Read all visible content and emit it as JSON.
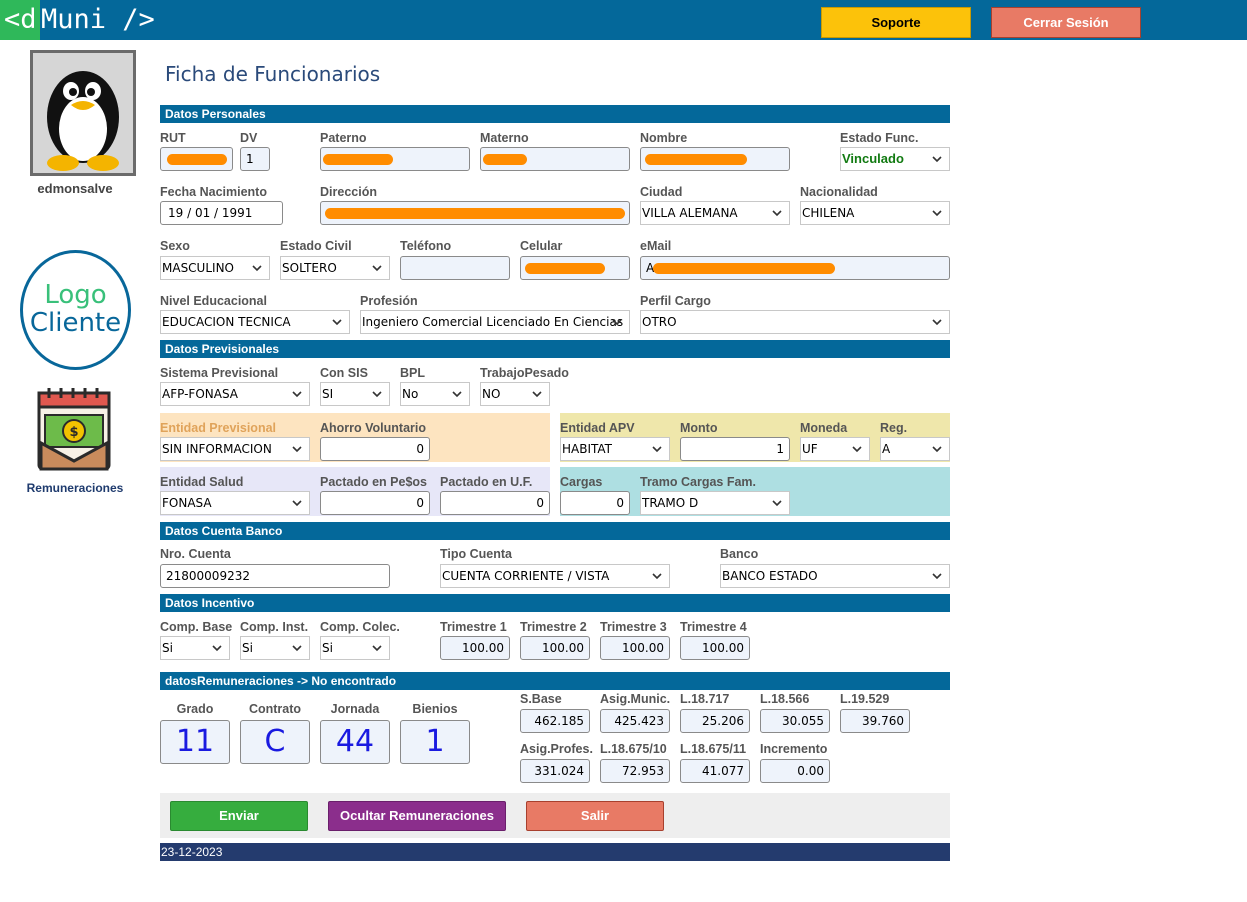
{
  "app": {
    "logo_d": "<d",
    "logo_rest": "Muni />"
  },
  "topbar": {
    "soporte": "Soporte",
    "cerrar_sesion": "Cerrar Sesión"
  },
  "sidebar": {
    "username": "edmonsalve",
    "client_logo_line1": "Logo",
    "client_logo_line2": "Cliente",
    "remuneraciones": "Remuneraciones"
  },
  "page": {
    "title": "Ficha de Funcionarios"
  },
  "sections": {
    "personales": "Datos Personales",
    "previsionales": "Datos Previsionales",
    "banco": "Datos Cuenta Banco",
    "incentivo": "Datos Incentivo",
    "remuneraciones": "datosRemuneraciones -> No encontrado"
  },
  "personales": {
    "rut": {
      "label": "RUT",
      "value": ""
    },
    "dv": {
      "label": "DV",
      "value": "1"
    },
    "paterno": {
      "label": "Paterno",
      "value": ""
    },
    "materno": {
      "label": "Materno",
      "value": ""
    },
    "nombre": {
      "label": "Nombre",
      "value": ""
    },
    "estado_func": {
      "label": "Estado Func.",
      "value": "Vinculado"
    },
    "fecha_nac": {
      "label": "Fecha Nacimiento",
      "value": "19 / 01 / 1991"
    },
    "direccion": {
      "label": "Dirección",
      "value": ""
    },
    "ciudad": {
      "label": "Ciudad",
      "value": "VILLA ALEMANA"
    },
    "nacionalidad": {
      "label": "Nacionalidad",
      "value": "CHILENA"
    },
    "sexo": {
      "label": "Sexo",
      "value": "MASCULINO"
    },
    "estado_civil": {
      "label": "Estado Civil",
      "value": "SOLTERO"
    },
    "telefono": {
      "label": "Teléfono",
      "value": ""
    },
    "celular": {
      "label": "Celular",
      "value": ""
    },
    "email": {
      "label": "eMail",
      "value": "A"
    },
    "nivel_educ": {
      "label": "Nivel Educacional",
      "value": "EDUCACION TECNICA"
    },
    "profesion": {
      "label": "Profesión",
      "value": "Ingeniero Comercial Licenciado En Ciencias"
    },
    "perfil_cargo": {
      "label": "Perfil Cargo",
      "value": "OTRO"
    }
  },
  "previsionales": {
    "sistema": {
      "label": "Sistema Previsional",
      "value": "AFP-FONASA"
    },
    "con_sis": {
      "label": "Con SIS",
      "value": "SI"
    },
    "bpl": {
      "label": "BPL",
      "value": "No"
    },
    "trabajo_pesado": {
      "label": "TrabajoPesado",
      "value": "NO"
    },
    "entidad_prev": {
      "label": "Entidad Previsional",
      "value": "SIN INFORMACION"
    },
    "ahorro_vol": {
      "label": "Ahorro Voluntario",
      "value": "0"
    },
    "entidad_apv": {
      "label": "Entidad APV",
      "value": "HABITAT"
    },
    "monto": {
      "label": "Monto",
      "value": "1"
    },
    "moneda": {
      "label": "Moneda",
      "value": "UF"
    },
    "reg": {
      "label": "Reg.",
      "value": "A"
    },
    "entidad_salud": {
      "label": "Entidad Salud",
      "value": "FONASA"
    },
    "pactado_pesos": {
      "label": "Pactado en Pe$os",
      "value": "0"
    },
    "pactado_uf": {
      "label": "Pactado en U.F.",
      "value": "0"
    },
    "cargas": {
      "label": "Cargas",
      "value": "0"
    },
    "tramo": {
      "label": "Tramo Cargas Fam.",
      "value": "TRAMO D"
    }
  },
  "banco": {
    "nro_cuenta": {
      "label": "Nro. Cuenta",
      "value": "21800009232"
    },
    "tipo_cuenta": {
      "label": "Tipo Cuenta",
      "value": "CUENTA CORRIENTE / VISTA"
    },
    "banco": {
      "label": "Banco",
      "value": "BANCO ESTADO"
    }
  },
  "incentivo": {
    "comp_base": {
      "label": "Comp. Base",
      "value": "Si"
    },
    "comp_inst": {
      "label": "Comp. Inst.",
      "value": "Si"
    },
    "comp_colec": {
      "label": "Comp. Colec.",
      "value": "Si"
    },
    "t1": {
      "label": "Trimestre 1",
      "value": "100.00"
    },
    "t2": {
      "label": "Trimestre 2",
      "value": "100.00"
    },
    "t3": {
      "label": "Trimestre 3",
      "value": "100.00"
    },
    "t4": {
      "label": "Trimestre 4",
      "value": "100.00"
    }
  },
  "remuneraciones": {
    "grado": {
      "label": "Grado",
      "value": "11"
    },
    "contrato": {
      "label": "Contrato",
      "value": "C"
    },
    "jornada": {
      "label": "Jornada",
      "value": "44"
    },
    "bienios": {
      "label": "Bienios",
      "value": "1"
    },
    "sbase": {
      "label": "S.Base",
      "value": "462.185"
    },
    "asig_munic": {
      "label": "Asig.Munic.",
      "value": "425.423"
    },
    "l18717": {
      "label": "L.18.717",
      "value": "25.206"
    },
    "l18566": {
      "label": "L.18.566",
      "value": "30.055"
    },
    "l19529": {
      "label": "L.19.529",
      "value": "39.760"
    },
    "asig_profes": {
      "label": "Asig.Profes.",
      "value": "331.024"
    },
    "l18675_10": {
      "label": "L.18.675/10",
      "value": "72.953"
    },
    "l18675_11": {
      "label": "L.18.675/11",
      "value": "41.077"
    },
    "incremento": {
      "label": "Incremento",
      "value": "0.00"
    }
  },
  "actions": {
    "enviar": "Enviar",
    "ocultar": "Ocultar Remuneraciones",
    "salir": "Salir"
  },
  "footer": {
    "date": "23-12-2023"
  },
  "colors": {
    "header_blue": "#04689a",
    "green_logo": "#2fb85a",
    "soporte": "#fcc20a",
    "cerrar": "#e87a65",
    "panel_orange": "#fde4c0",
    "panel_yellow": "#efe7ab",
    "panel_lavender": "#e7e7f8",
    "panel_cyan": "#aedfe2",
    "btn_enviar": "#36ad3e",
    "btn_ocultar": "#8b2e8c",
    "btn_salir": "#e87a65",
    "footer": "#243b6e"
  }
}
